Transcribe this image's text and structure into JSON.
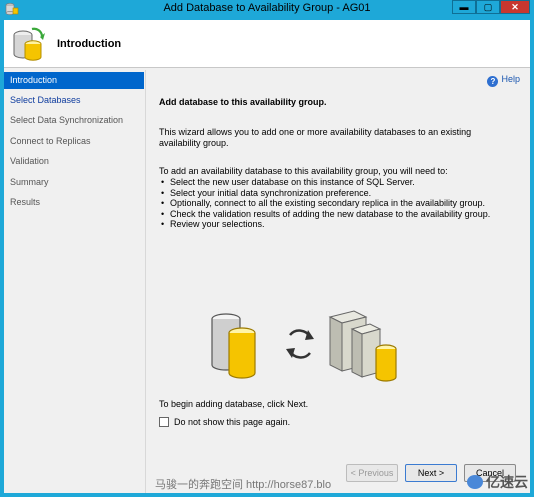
{
  "window": {
    "title": "Add Database to Availability Group - AG01",
    "controls": {
      "minimize": "▬",
      "maximize": "▢",
      "close": "✕"
    }
  },
  "header": {
    "title": "Introduction"
  },
  "nav": {
    "items": [
      {
        "label": "Introduction",
        "state": "active"
      },
      {
        "label": "Select Databases",
        "state": "link"
      },
      {
        "label": "Select Data Synchronization",
        "state": "disabled"
      },
      {
        "label": "Connect to Replicas",
        "state": "disabled"
      },
      {
        "label": "Validation",
        "state": "disabled"
      },
      {
        "label": "Summary",
        "state": "disabled"
      },
      {
        "label": "Results",
        "state": "disabled"
      }
    ]
  },
  "content": {
    "help_label": "Help",
    "heading": "Add database to this availability group.",
    "paragraph": "This wizard allows you to add one or more availability databases to an existing availability group.",
    "steps_intro": "To add an availability database to this availability group, you will need to:",
    "steps": [
      "Select the new user database on this instance of SQL Server.",
      "Select your initial data synchronization preference.",
      "Optionally, connect to all the existing secondary replica in the availability group.",
      "Check the validation results of adding the new database to the availability group.",
      "Review your selections."
    ],
    "begin_text": "To begin adding database, click Next.",
    "checkbox_label": "Do not show this page again.",
    "checkbox_checked": false
  },
  "buttons": {
    "previous": "< Previous",
    "next": "Next >",
    "cancel": "Cancel"
  },
  "overlay": {
    "watermark": "马骏一的奔跑空间 http://horse87.blo",
    "logo": "亿速云"
  },
  "colors": {
    "titlebar": "#1ea8d8",
    "nav_active": "#0066cc",
    "link": "#0f3c9e"
  }
}
